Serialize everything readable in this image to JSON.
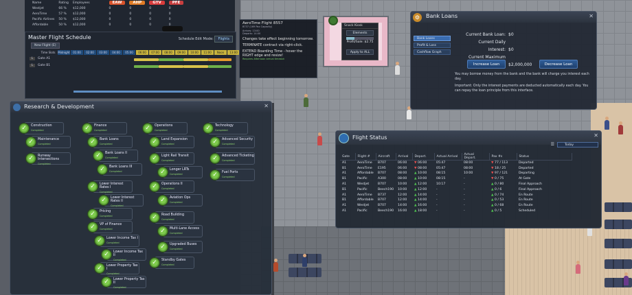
{
  "colors": {
    "ear": "#d9532b",
    "ahp": "#e07b25",
    "gfv": "#d83b3b",
    "pfe": "#c73e3e",
    "accent": "#3a6cb0"
  },
  "stats": {
    "headers": [
      "Name",
      "Rating",
      "Employees"
    ],
    "badges": [
      "EAW",
      "AHP",
      "GTV",
      "PFE"
    ],
    "rows": [
      {
        "name": "Westjet",
        "rating": "66 %",
        "employees": "$12,000",
        "v": [
          "0",
          "0",
          "0",
          "0"
        ]
      },
      {
        "name": "AeroTime",
        "rating": "57 %",
        "employees": "$12,000",
        "v": [
          "0",
          "0",
          "0",
          "0"
        ]
      },
      {
        "name": "Pacific Airlines",
        "rating": "50 %",
        "employees": "$12,000",
        "v": [
          "0",
          "0",
          "0",
          "0"
        ]
      },
      {
        "name": "Affordable",
        "rating": "50 %",
        "employees": "$12,000",
        "v": [
          "0",
          "0",
          "0",
          "0"
        ]
      }
    ]
  },
  "schedule": {
    "title": "Master Flight Schedule",
    "edit_mode_label": "Schedule Edit Mode:",
    "edit_mode_value": "Flights",
    "new_flight": "New Flight (E)",
    "time_slots_label": "Time Slots",
    "slots": [
      "Midnight",
      "01:00",
      "02:00",
      "03:00",
      "04:00",
      "05:00",
      "06:00",
      "07:00",
      "08:00",
      "09:00",
      "10:00",
      "11:00",
      "Noon",
      "13:00"
    ],
    "rows": [
      {
        "letter": "L",
        "name": "Gate A1"
      },
      {
        "letter": "L",
        "name": "Gate B1"
      }
    ]
  },
  "tooltip": {
    "title": "AeroTime Flight 8557",
    "sub1": "B737 (169 Pax Capacity)",
    "sub2": "Arrives: 13:00",
    "sub3": "Departs: 14:00",
    "line1": "Changes take effect beginning tomorrow.",
    "line2": "TERMINATE contract via right-click.",
    "line3": "EXTEND Boarding Time - hover the RIGHT edge and resize!",
    "green": "Requires Afternoon arrival timeslot"
  },
  "snack": {
    "header": "Snack Kiosk",
    "btn1": "Elements",
    "profit": "Profit/Sale: $2.75",
    "apply": "Apply to ALL",
    "level": 0.3
  },
  "bank": {
    "title": "Bank Loans",
    "tabs": [
      "Bank Loans",
      "Profit & Loss",
      "Cashflow Graph"
    ],
    "current_loan_label": "Current Bank Loan:",
    "current_loan": "$0",
    "daily_interest_label": "Current Daily Interest:",
    "daily_interest": "$0",
    "max_loan_label": "Current Maximum Loan:",
    "max_loan": "$2,000,000",
    "increase": "Increase Loan",
    "decrease": "Decrease Loan",
    "note1": "You may borrow money from the bank and the bank will charge you interest each day.",
    "note2": "Important:  Only the interest payments are deducted automatically each day.  You can repay the loan principle from this interface."
  },
  "rnd": {
    "title": "Research & Development",
    "completed": "Completed",
    "nodes": [
      "Construction",
      "Maintenance",
      "Runway Intersections",
      "Finance",
      "Bank Loans",
      "Bank Loans II",
      "Bank Loans III",
      "Lower Interest Rates I",
      "Lower Interest Rates II",
      "Pricing",
      "VP of Finance",
      "Lower Income Tax I",
      "Lower Income Tax II",
      "Lower Property Tax I",
      "Lower Property Tax II",
      "Operations",
      "Land Expansion",
      "Light Rail Transit",
      "Longer LRTs",
      "Operations II",
      "Aviation Ops",
      "Road Building",
      "Multi-Lane Access",
      "Upgraded Buses",
      "Standby Gates",
      "Technology",
      "Advanced Security",
      "Advanced Ticketing",
      "Fuel Ports"
    ]
  },
  "fstatus": {
    "title": "Flight Status",
    "filter": "Today",
    "headers": [
      "Gate",
      "Flight #",
      "Aircraft",
      "Arrival",
      "Depart.",
      "Actual Arrival",
      "Actual Depart.",
      "Pax #s",
      "Status"
    ],
    "rows": [
      [
        "A1",
        "AeroTime",
        "B707",
        "06:00",
        "06:00",
        "05:47",
        "08:00",
        "77 / 113",
        "Departed"
      ],
      [
        "B1",
        "AeroTime",
        "E195",
        "06:00",
        "08:00",
        "05:47",
        "08:00",
        "18 / 25",
        "Departed"
      ],
      [
        "A1",
        "Affordable",
        "B707",
        "08:00",
        "10:00",
        "08:15",
        "10:00",
        "97 / 121",
        "Departing"
      ],
      [
        "B1",
        "Pacific",
        "A300",
        "08:00",
        "10:00",
        "08:15",
        "-",
        "0 / 75",
        "At Gate"
      ],
      [
        "A1",
        "Westjet",
        "B707",
        "10:00",
        "12:00",
        "10:17",
        "-",
        "0 / 80",
        "Final Approach"
      ],
      [
        "B1",
        "Pacific",
        "Beech190",
        "10:00",
        "12:00",
        "-",
        "-",
        "0 / 6",
        "Final Approach"
      ],
      [
        "A1",
        "AeroTime",
        "B737",
        "12:00",
        "14:00",
        "-",
        "-",
        "0 / 74",
        "En Route"
      ],
      [
        "B1",
        "Affordable",
        "B707",
        "12:00",
        "14:00",
        "-",
        "-",
        "0 / 53",
        "En Route"
      ],
      [
        "A1",
        "Westjet",
        "B707",
        "14:00",
        "16:00",
        "-",
        "-",
        "0 / 68",
        "En Route"
      ],
      [
        "A1",
        "Pacific",
        "Beech190",
        "16:00",
        "18:00",
        "-",
        "-",
        "0 / 5",
        "Scheduled"
      ]
    ],
    "depart_markers": [
      "down",
      "down",
      "up",
      "up",
      "up",
      "up",
      "up",
      "up",
      "up",
      "up"
    ],
    "pax_markers": [
      "down",
      "down",
      "down",
      "down",
      "up",
      "up",
      "up",
      "up",
      "up",
      "up"
    ]
  }
}
